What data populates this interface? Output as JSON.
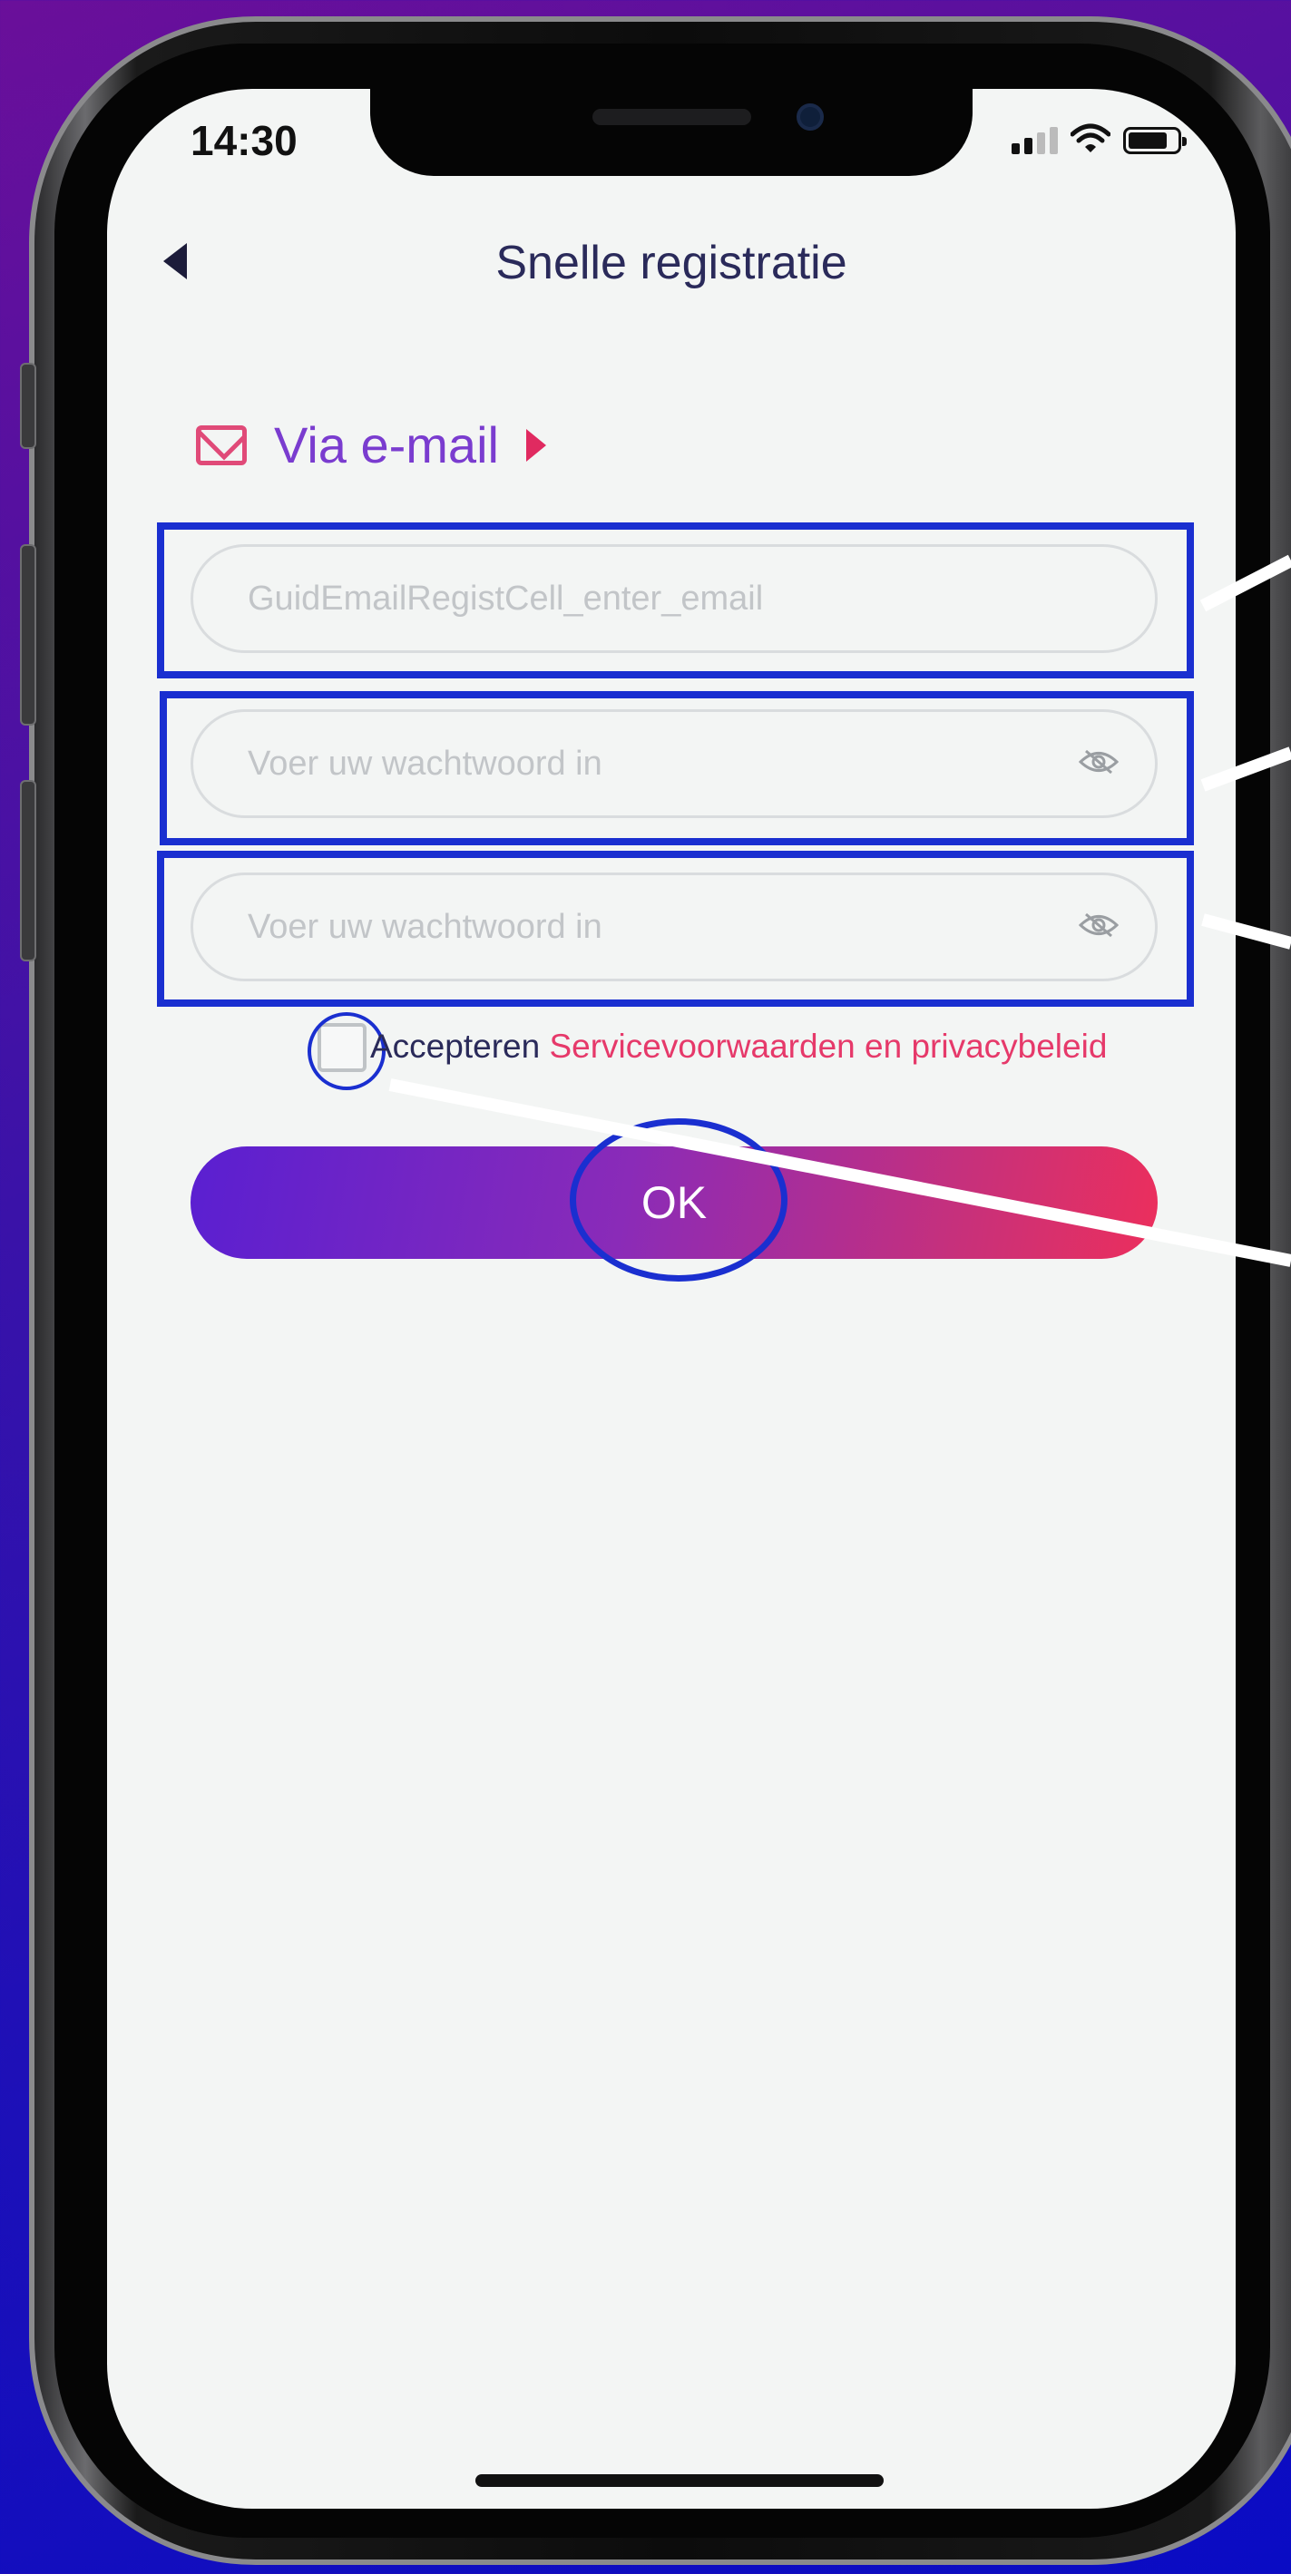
{
  "status_bar": {
    "time": "14:30"
  },
  "header": {
    "title": "Snelle registratie"
  },
  "via": {
    "label": "Via e-mail"
  },
  "form": {
    "email_placeholder": "GuidEmailRegistCell_enter_email",
    "password_placeholder": "Voer uw wachtwoord in",
    "confirm_password_placeholder": "Voer uw wachtwoord in"
  },
  "agreement": {
    "accept_label": "Accepteren",
    "terms_link": "Servicevoorwaarden en privacybeleid",
    "checked": false
  },
  "submit": {
    "label": "OK"
  },
  "colors": {
    "accent_purple": "#7a3ccf",
    "accent_pink": "#e6396a",
    "annotation_blue": "#1a2fd0"
  },
  "icons": [
    "back-arrow-icon",
    "mail-icon",
    "play-arrow-icon",
    "eye-off-icon",
    "signal-icon",
    "wifi-icon",
    "battery-icon"
  ]
}
